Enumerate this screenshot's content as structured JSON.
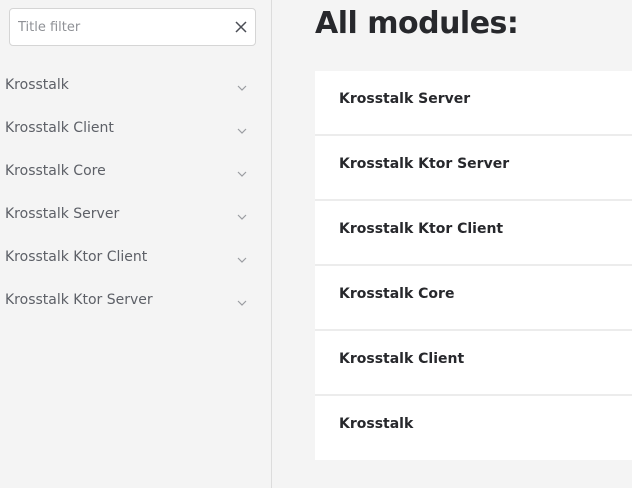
{
  "search": {
    "placeholder": "Title filter",
    "value": ""
  },
  "sidebar": {
    "items": [
      {
        "label": "Krosstalk"
      },
      {
        "label": "Krosstalk Client"
      },
      {
        "label": "Krosstalk Core"
      },
      {
        "label": "Krosstalk Server"
      },
      {
        "label": "Krosstalk Ktor Client"
      },
      {
        "label": "Krosstalk Ktor Server"
      }
    ]
  },
  "main": {
    "title": "All modules:",
    "modules": [
      {
        "label": "Krosstalk Server"
      },
      {
        "label": "Krosstalk Ktor Server"
      },
      {
        "label": "Krosstalk Ktor Client"
      },
      {
        "label": "Krosstalk Core"
      },
      {
        "label": "Krosstalk Client"
      },
      {
        "label": "Krosstalk"
      }
    ]
  },
  "icons": {
    "clear": "close-icon",
    "expand": "chevron-down-icon"
  }
}
